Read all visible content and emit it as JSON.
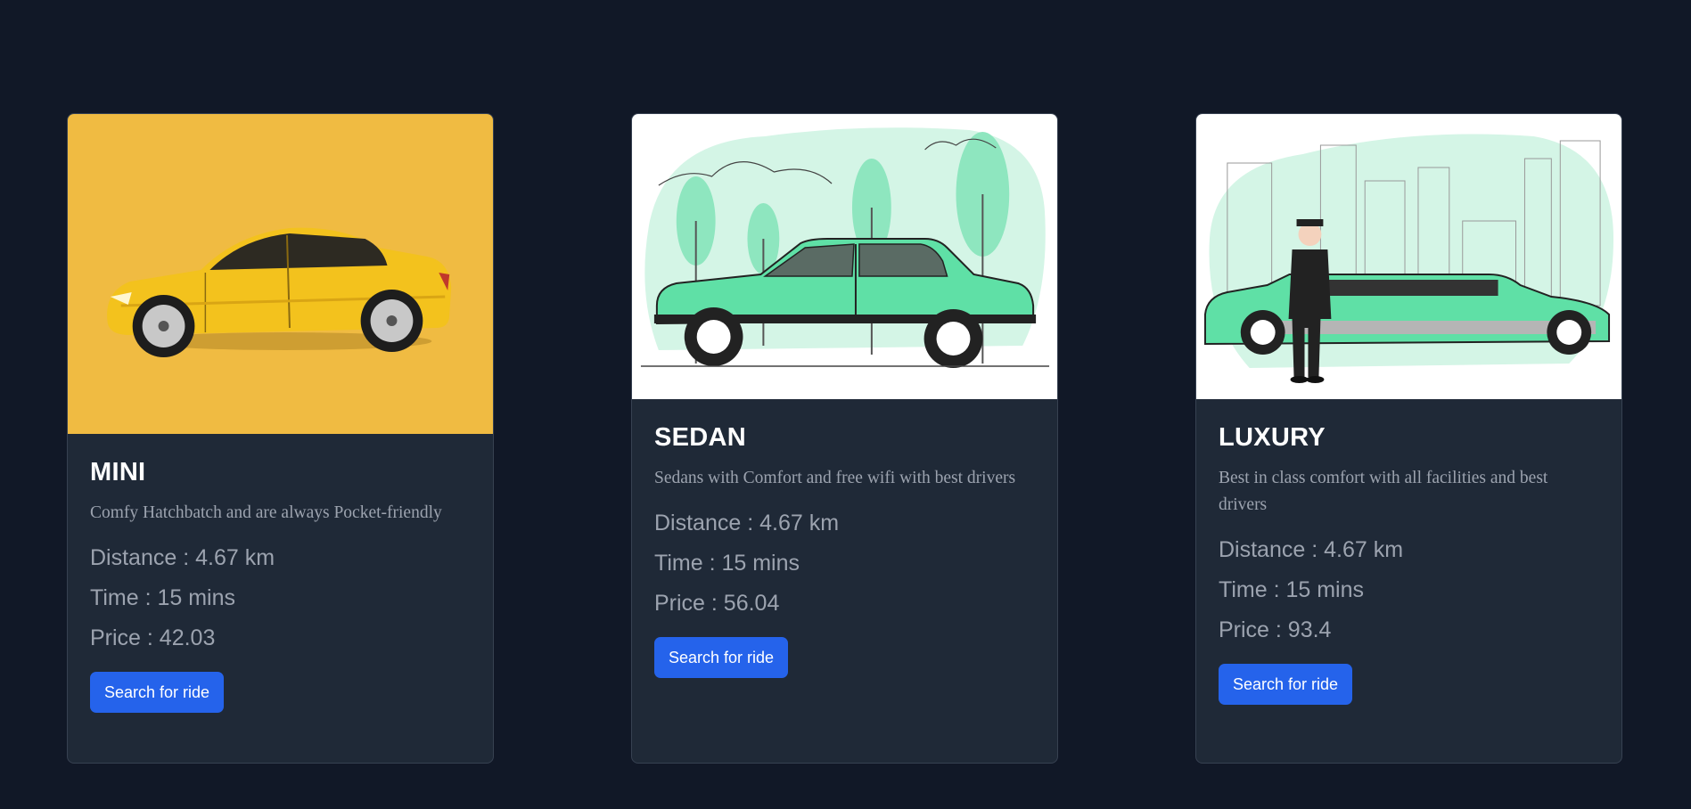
{
  "cards": [
    {
      "title": "MINI",
      "description": "Comfy Hatchbatch and are always Pocket-friendly",
      "distance": "Distance : 4.67 km",
      "time": "Time : 15 mins",
      "price": "Price : 42.03",
      "button_label": "Search for ride",
      "image_icon": "yellow-sedan-car-photo"
    },
    {
      "title": "SEDAN",
      "description": "Sedans with Comfort and free wifi with best drivers",
      "distance": "Distance : 4.67 km",
      "time": "Time : 15 mins",
      "price": "Price : 56.04",
      "button_label": "Search for ride",
      "image_icon": "green-sedan-illustration"
    },
    {
      "title": "LUXURY",
      "description": "Best in class comfort with all facilities and best drivers",
      "distance": "Distance : 4.67 km",
      "time": "Time : 15 mins",
      "price": "Price : 93.4",
      "button_label": "Search for ride",
      "image_icon": "limousine-chauffeur-illustration"
    }
  ],
  "colors": {
    "page_background": "#111827",
    "card_background": "#1f2937",
    "button": "#2563eb",
    "mini_image_bg": "#f0bb42",
    "illustration_green": "#5fe0a6"
  }
}
